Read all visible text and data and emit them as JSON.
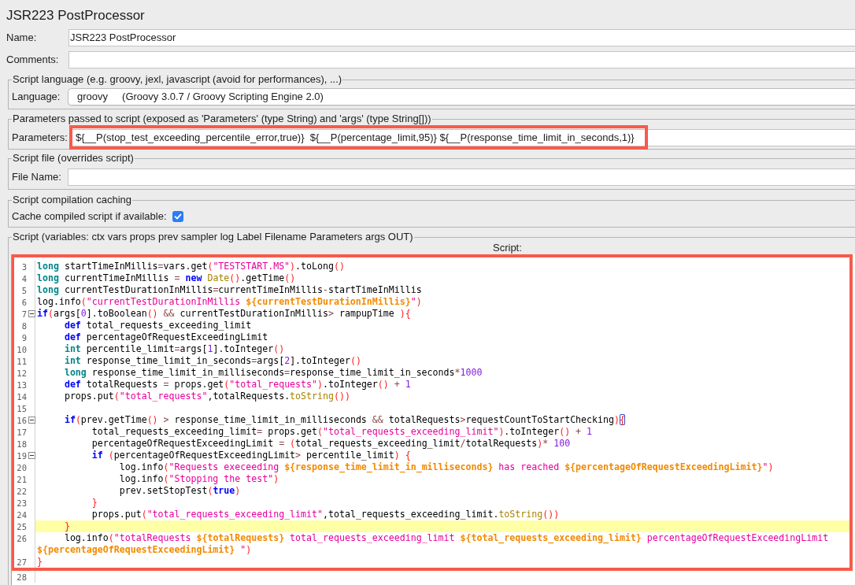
{
  "title": "JSR223 PostProcessor",
  "name": {
    "label": "Name:",
    "value": "JSR223 PostProcessor"
  },
  "comments": {
    "label": "Comments:"
  },
  "script_language": {
    "title": "Script language (e.g. groovy, jexl, javascript (avoid for performances), ...)",
    "label": "Language:",
    "value": "groovy     (Groovy 3.0.7 / Groovy Scripting Engine 2.0)"
  },
  "parameters": {
    "title": "Parameters passed to script (exposed as 'Parameters' (type String) and 'args' (type String[]))",
    "label": "Parameters:",
    "value": "${__P(stop_test_exceeding_percentile_error,true)}  ${__P(percentage_limit,95)} ${__P(response_time_limit_in_seconds,1)}",
    "annotated": true
  },
  "script_file": {
    "title": "Script file (overrides script)",
    "label": "File Name:"
  },
  "compilation_caching": {
    "title": "Script compilation caching",
    "label": "Cache compiled script if available:",
    "checked": true
  },
  "script": {
    "title": "Script (variables: ctx vars props prev sampler log Label Filename Parameters args OUT)",
    "label": "Script:",
    "blocks": [
      {
        "annotated": true,
        "lines": [
          {
            "number": "3",
            "current": false,
            "foldable": false,
            "tokens": [
              {
                "kind": "type",
                "text": "long"
              },
              {
                "kind": "plain",
                "text": " startTimeInMillis"
              },
              {
                "kind": "operator",
                "text": "="
              },
              {
                "kind": "plain",
                "text": "vars.get"
              },
              {
                "kind": "bracket",
                "text": "("
              },
              {
                "kind": "string",
                "text": "\"TESTSTART.MS\""
              },
              {
                "kind": "bracket",
                "text": ")"
              },
              {
                "kind": "plain",
                "text": ".toLong"
              },
              {
                "kind": "bracket",
                "text": "()"
              }
            ]
          },
          {
            "number": "4",
            "current": false,
            "foldable": false,
            "tokens": [
              {
                "kind": "type",
                "text": "long"
              },
              {
                "kind": "plain",
                "text": " currentTimeInMillis "
              },
              {
                "kind": "operator",
                "text": "= "
              },
              {
                "kind": "keyword",
                "text": "new"
              },
              {
                "kind": "library",
                "text": " Date"
              },
              {
                "kind": "bracket",
                "text": "()"
              },
              {
                "kind": "plain",
                "text": ".getTime"
              },
              {
                "kind": "bracket",
                "text": "()"
              }
            ]
          },
          {
            "number": "5",
            "current": false,
            "foldable": false,
            "tokens": [
              {
                "kind": "type",
                "text": "long"
              },
              {
                "kind": "plain",
                "text": " currentTestDurationInMillis"
              },
              {
                "kind": "operator",
                "text": "="
              },
              {
                "kind": "plain",
                "text": "currentTimeInMillis"
              },
              {
                "kind": "operator",
                "text": "-"
              },
              {
                "kind": "plain",
                "text": "startTimeInMillis"
              }
            ]
          },
          {
            "number": "6",
            "current": false,
            "foldable": false,
            "tokens": [
              {
                "kind": "plain",
                "text": "log.info"
              },
              {
                "kind": "bracket",
                "text": "("
              },
              {
                "kind": "string",
                "text": "\"currentTestDurationInMillis "
              },
              {
                "kind": "interpolation",
                "text": "${currentTestDurationInMillis}"
              },
              {
                "kind": "string",
                "text": "\""
              },
              {
                "kind": "bracket",
                "text": ")"
              }
            ]
          },
          {
            "number": "7",
            "current": false,
            "foldable": true,
            "tokens": [
              {
                "kind": "keyword",
                "text": "if"
              },
              {
                "kind": "bracket",
                "text": "("
              },
              {
                "kind": "plain",
                "text": "args["
              },
              {
                "kind": "number",
                "text": "0"
              },
              {
                "kind": "plain",
                "text": "].toBoolean"
              },
              {
                "kind": "bracket",
                "text": "()"
              },
              {
                "kind": "operator",
                "text": " &&"
              },
              {
                "kind": "plain",
                "text": " currentTestDurationInMillis"
              },
              {
                "kind": "operator",
                "text": ">"
              },
              {
                "kind": "plain",
                "text": " rampupTime "
              },
              {
                "kind": "bracket",
                "text": "){"
              }
            ]
          },
          {
            "number": "8",
            "current": false,
            "foldable": false,
            "tokens": [
              {
                "kind": "keyword",
                "text": "\tdef"
              },
              {
                "kind": "plain",
                "text": " total_requests_exceeding_limit"
              }
            ]
          },
          {
            "number": "9",
            "current": false,
            "foldable": false,
            "tokens": [
              {
                "kind": "keyword",
                "text": "\tdef"
              },
              {
                "kind": "plain",
                "text": " percentageOfRequestExceedingLimit"
              }
            ]
          },
          {
            "number": "10",
            "current": false,
            "foldable": false,
            "tokens": [
              {
                "kind": "type",
                "text": "\tint"
              },
              {
                "kind": "plain",
                "text": " percentile_limit"
              },
              {
                "kind": "operator",
                "text": "="
              },
              {
                "kind": "plain",
                "text": "args["
              },
              {
                "kind": "number",
                "text": "1"
              },
              {
                "kind": "plain",
                "text": "].toInteger"
              },
              {
                "kind": "bracket",
                "text": "()"
              }
            ]
          },
          {
            "number": "11",
            "current": false,
            "foldable": false,
            "tokens": [
              {
                "kind": "type",
                "text": "\tint"
              },
              {
                "kind": "plain",
                "text": " response_time_limit_in_seconds"
              },
              {
                "kind": "operator",
                "text": "="
              },
              {
                "kind": "plain",
                "text": "args["
              },
              {
                "kind": "number",
                "text": "2"
              },
              {
                "kind": "plain",
                "text": "].toInteger"
              },
              {
                "kind": "bracket",
                "text": "()"
              }
            ]
          },
          {
            "number": "12",
            "current": false,
            "foldable": false,
            "tokens": [
              {
                "kind": "type",
                "text": "\tlong"
              },
              {
                "kind": "plain",
                "text": " response_time_limit_in_milliseconds"
              },
              {
                "kind": "operator",
                "text": "="
              },
              {
                "kind": "plain",
                "text": "response_time_limit_in_seconds"
              },
              {
                "kind": "operator",
                "text": "*"
              },
              {
                "kind": "number",
                "text": "1000"
              }
            ]
          },
          {
            "number": "13",
            "current": false,
            "foldable": false,
            "tokens": [
              {
                "kind": "keyword",
                "text": "\tdef"
              },
              {
                "kind": "plain",
                "text": " totalRequests "
              },
              {
                "kind": "operator",
                "text": "="
              },
              {
                "kind": "plain",
                "text": " props.get"
              },
              {
                "kind": "bracket",
                "text": "("
              },
              {
                "kind": "string",
                "text": "\"total_requests\""
              },
              {
                "kind": "bracket",
                "text": ")"
              },
              {
                "kind": "plain",
                "text": ".toInteger"
              },
              {
                "kind": "bracket",
                "text": "()"
              },
              {
                "kind": "operator",
                "text": " + "
              },
              {
                "kind": "number",
                "text": "1"
              }
            ]
          },
          {
            "number": "14",
            "current": false,
            "foldable": false,
            "tokens": [
              {
                "kind": "plain",
                "text": "\tprops.put"
              },
              {
                "kind": "bracket",
                "text": "("
              },
              {
                "kind": "string",
                "text": "\"total_requests\""
              },
              {
                "kind": "plain",
                "text": ",totalRequests."
              },
              {
                "kind": "library",
                "text": "toString"
              },
              {
                "kind": "bracket",
                "text": "())"
              }
            ]
          },
          {
            "number": "15",
            "current": false,
            "foldable": false
          },
          {
            "number": "16",
            "current": false,
            "foldable": true,
            "tokens": [
              {
                "kind": "keyword",
                "text": "\tif"
              },
              {
                "kind": "bracket",
                "text": "("
              },
              {
                "kind": "plain",
                "text": "prev.getTime"
              },
              {
                "kind": "bracket",
                "text": "()"
              },
              {
                "kind": "operator",
                "text": " >"
              },
              {
                "kind": "plain",
                "text": " response_time_limit_in_milliseconds "
              },
              {
                "kind": "operator",
                "text": "&&"
              },
              {
                "kind": "plain",
                "text": " totalRequests"
              },
              {
                "kind": "operator",
                "text": ">"
              },
              {
                "kind": "plain",
                "text": "requestCountToStartChecking"
              },
              {
                "kind": "bracket",
                "text": ")"
              },
              {
                "kind": "matched_bracket",
                "text": "{"
              }
            ]
          },
          {
            "number": "17",
            "current": false,
            "foldable": false,
            "tokens": [
              {
                "kind": "plain",
                "text": "\t\ttotal_requests_exceeding_limit"
              },
              {
                "kind": "operator",
                "text": "="
              },
              {
                "kind": "plain",
                "text": " props.get"
              },
              {
                "kind": "bracket",
                "text": "("
              },
              {
                "kind": "string",
                "text": "\"total_requests_exceeding_limit\""
              },
              {
                "kind": "bracket",
                "text": ")"
              },
              {
                "kind": "plain",
                "text": ".toInteger"
              },
              {
                "kind": "bracket",
                "text": "()"
              },
              {
                "kind": "operator",
                "text": " + "
              },
              {
                "kind": "number",
                "text": "1"
              }
            ]
          },
          {
            "number": "18",
            "current": false,
            "foldable": false,
            "tokens": [
              {
                "kind": "plain",
                "text": "\t\tpercentageOfRequestExceedingLimit "
              },
              {
                "kind": "operator",
                "text": "= "
              },
              {
                "kind": "bracket",
                "text": "("
              },
              {
                "kind": "plain",
                "text": "total_requests_exceeding_limit"
              },
              {
                "kind": "operator",
                "text": "/"
              },
              {
                "kind": "plain",
                "text": "totalRequests"
              },
              {
                "kind": "bracket",
                "text": ")"
              },
              {
                "kind": "operator",
                "text": "* "
              },
              {
                "kind": "number",
                "text": "100"
              }
            ]
          },
          {
            "number": "19",
            "current": false,
            "foldable": true,
            "tokens": [
              {
                "kind": "keyword",
                "text": "\t\tif"
              },
              {
                "kind": "bracket",
                "text": " ("
              },
              {
                "kind": "plain",
                "text": "percentageOfRequestExceedingLimit"
              },
              {
                "kind": "operator",
                "text": ">"
              },
              {
                "kind": "plain",
                "text": " percentile_limit"
              },
              {
                "kind": "bracket",
                "text": ") {"
              }
            ]
          },
          {
            "number": "20",
            "current": false,
            "foldable": false,
            "tokens": [
              {
                "kind": "plain",
                "text": "\t\t\tlog.info"
              },
              {
                "kind": "bracket",
                "text": "("
              },
              {
                "kind": "string",
                "text": "\"Requests execeeding "
              },
              {
                "kind": "interpolation",
                "text": "${response_time_limit_in_milliseconds}"
              },
              {
                "kind": "string",
                "text": " has reached "
              },
              {
                "kind": "interpolation",
                "text": "${percentageOfRequestExceedingLimit}"
              },
              {
                "kind": "string",
                "text": "\""
              },
              {
                "kind": "bracket",
                "text": ")"
              }
            ]
          },
          {
            "number": "21",
            "current": false,
            "foldable": false,
            "tokens": [
              {
                "kind": "plain",
                "text": "\t\t\tlog.info"
              },
              {
                "kind": "bracket",
                "text": "("
              },
              {
                "kind": "string",
                "text": "\"Stopping the test\""
              },
              {
                "kind": "bracket",
                "text": ")"
              }
            ]
          },
          {
            "number": "22",
            "current": false,
            "foldable": false,
            "tokens": [
              {
                "kind": "plain",
                "text": "\t\t\tprev.setStopTest"
              },
              {
                "kind": "bracket",
                "text": "("
              },
              {
                "kind": "keyword",
                "text": "true"
              },
              {
                "kind": "bracket",
                "text": ")"
              }
            ]
          },
          {
            "number": "23",
            "current": false,
            "foldable": false,
            "tokens": [
              {
                "kind": "bracket",
                "text": "\t\t}"
              }
            ]
          },
          {
            "number": "24",
            "current": false,
            "foldable": false,
            "tokens": [
              {
                "kind": "plain",
                "text": "\t\tprops.put"
              },
              {
                "kind": "bracket",
                "text": "("
              },
              {
                "kind": "string",
                "text": "\"total_requests_exceeding_limit\""
              },
              {
                "kind": "plain",
                "text": ",total_requests_exceeding_limit."
              },
              {
                "kind": "library",
                "text": "toString"
              },
              {
                "kind": "bracket",
                "text": "())"
              }
            ]
          },
          {
            "number": "25",
            "current": true,
            "foldable": false,
            "tokens": [
              {
                "kind": "bracket",
                "text": "\t}"
              }
            ]
          },
          {
            "number": "26",
            "current": false,
            "foldable": false,
            "tokens": [
              {
                "kind": "plain",
                "text": "\tlog.info"
              },
              {
                "kind": "bracket",
                "text": "("
              },
              {
                "kind": "string",
                "text": "\"totalRequests "
              },
              {
                "kind": "interpolation",
                "text": "${totalRequests}"
              },
              {
                "kind": "string",
                "text": " total_requests_exceeding_limit "
              },
              {
                "kind": "interpolation",
                "text": "${total_requests_exceeding_limit}"
              },
              {
                "kind": "string",
                "text": " percentageOfRequestExceedingLimit "
              },
              {
                "kind": "interpolation",
                "text": "${percentageOfRequestExceedingLimit}"
              },
              {
                "kind": "string",
                "text": " \""
              },
              {
                "kind": "bracket",
                "text": ")"
              }
            ]
          },
          {
            "number": "27",
            "current": false,
            "foldable": false,
            "tokens": [
              {
                "kind": "bracket",
                "text": "}"
              }
            ]
          }
        ]
      },
      {
        "annotated": false,
        "lines": [
          {
            "number": "28",
            "current": false,
            "foldable": false
          }
        ]
      }
    ]
  }
}
